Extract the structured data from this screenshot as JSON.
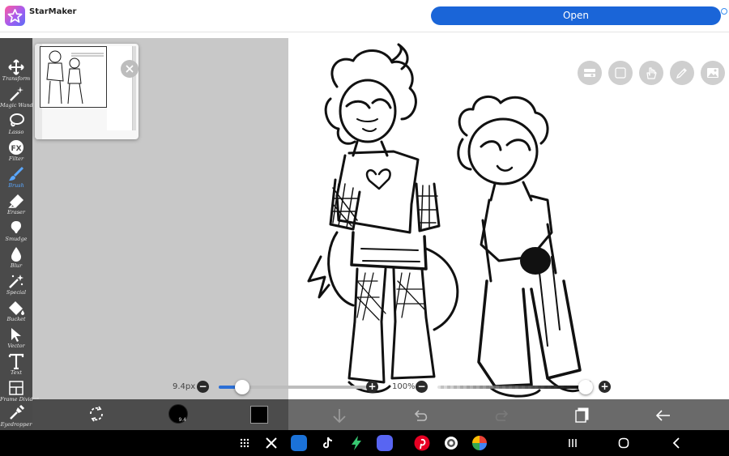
{
  "ad": {
    "app_name": "StarMaker",
    "button_label": "Open",
    "logo_icon": "starmaker-logo",
    "info_icon": "ad-choices-icon"
  },
  "tools": [
    {
      "label": "Transform",
      "icon": "transform-icon"
    },
    {
      "label": "Magic Wand",
      "icon": "magic-wand-icon"
    },
    {
      "label": "Lasso",
      "icon": "lasso-icon"
    },
    {
      "label": "Filter",
      "icon": "filter-icon"
    },
    {
      "label": "Brush",
      "icon": "brush-icon",
      "active": true
    },
    {
      "label": "Eraser",
      "icon": "eraser-icon"
    },
    {
      "label": "Smudge",
      "icon": "smudge-icon"
    },
    {
      "label": "Blur",
      "icon": "blur-icon"
    },
    {
      "label": "Special",
      "icon": "special-icon"
    },
    {
      "label": "Bucket",
      "icon": "bucket-icon"
    },
    {
      "label": "Vector",
      "icon": "vector-icon"
    },
    {
      "label": "Text",
      "icon": "text-icon"
    },
    {
      "label": "Frame Divider",
      "icon": "frame-divider-icon"
    },
    {
      "label": "Eyedropper",
      "icon": "eyedropper-icon"
    }
  ],
  "navigator": {
    "close_icon": "close-icon"
  },
  "top_right_buttons": [
    "layer-settings-icon",
    "blank-icon",
    "hand-icon",
    "pencil-ruler-icon",
    "gallery-icon"
  ],
  "brush_size": {
    "label": "9.4px",
    "level": 0.06,
    "minus": "−",
    "plus": "+"
  },
  "opacity": {
    "label": "100%",
    "level": 1.0,
    "minus": "−",
    "plus": "+"
  },
  "bottom_bar": {
    "brush_preview_value": "9.4",
    "current_color": "#000000",
    "icons": [
      "transform-rotate-icon",
      "brush-preview",
      "color-swatch",
      "download-icon",
      "undo-icon",
      "redo-icon",
      "layers-icon",
      "back-arrow-icon"
    ]
  },
  "system_nav": {
    "apps": [
      "app-grid-icon",
      "x-app-icon",
      "ibispaint-app-icon",
      "tiktok-app-icon",
      "lightning-app-icon",
      "discord-app-icon",
      "pinterest-app-icon",
      "settings-app-icon",
      "photos-app-icon"
    ],
    "recents_icon": "recents-icon",
    "home_icon": "home-icon",
    "back_icon": "back-icon"
  },
  "colors": {
    "accent": "#1a65d8",
    "toolbar": "#4a4a4a",
    "active_tool": "#5aa7ff",
    "workspace": "#c8c8c8"
  }
}
